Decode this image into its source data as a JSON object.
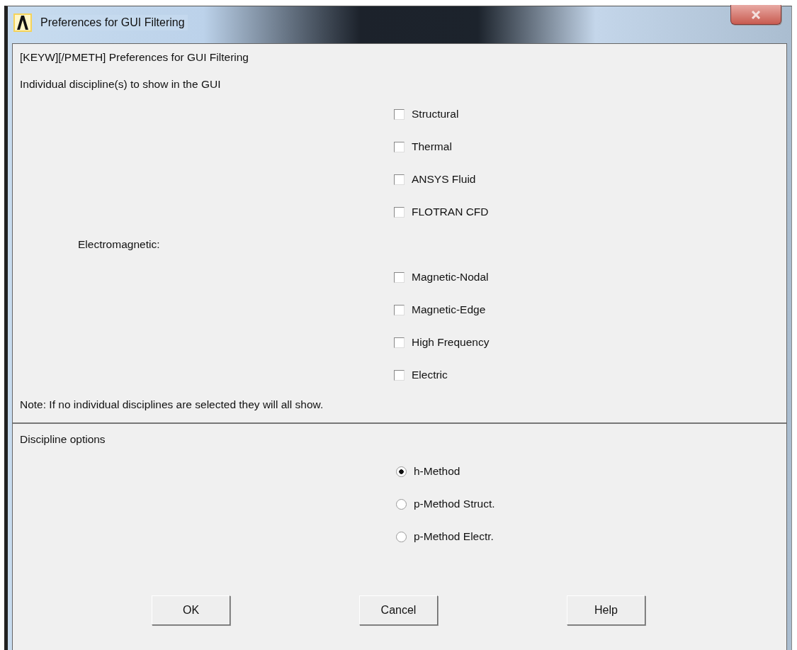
{
  "window": {
    "title": "Preferences for GUI Filtering"
  },
  "heading": "[KEYW][/PMETH] Preferences for GUI Filtering",
  "disciplines_label": "Individual discipline(s) to show in the GUI",
  "disciplines": [
    {
      "kind": "checkbox",
      "label": "Structural",
      "checked": false
    },
    {
      "kind": "checkbox",
      "label": "Thermal",
      "checked": false
    },
    {
      "kind": "checkbox",
      "label": "ANSYS Fluid",
      "checked": false
    },
    {
      "kind": "checkbox",
      "label": "FLOTRAN CFD",
      "checked": false
    },
    {
      "kind": "group",
      "label": "Electromagnetic:"
    },
    {
      "kind": "checkbox",
      "label": "Magnetic-Nodal",
      "checked": false
    },
    {
      "kind": "checkbox",
      "label": "Magnetic-Edge",
      "checked": false
    },
    {
      "kind": "checkbox",
      "label": "High Frequency",
      "checked": false
    },
    {
      "kind": "checkbox",
      "label": "Electric",
      "checked": false
    }
  ],
  "note": "Note: If no individual disciplines are selected they will all show.",
  "options_label": "Discipline options",
  "options": [
    {
      "label": "h-Method",
      "selected": true
    },
    {
      "label": "p-Method Struct.",
      "selected": false
    },
    {
      "label": "p-Method Electr.",
      "selected": false
    }
  ],
  "buttons": [
    "OK",
    "Cancel",
    "Help"
  ]
}
